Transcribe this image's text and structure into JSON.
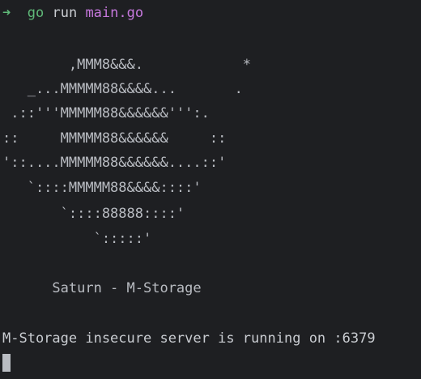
{
  "terminal": {
    "prompt": {
      "arrow": "➜",
      "command": "go",
      "subcommand": "run",
      "argument": "main.go"
    },
    "ascii_art": [
      "        ,MMM8&&&.            *",
      "   _...MMMMM88&&&&...       .",
      " .::'''MMMMM88&&&&&&''':.",
      "::     MMMMM88&&&&&&     ::",
      "'::....MMMMM88&&&&&&....::'",
      "   `::::MMMMM88&&&&::::'",
      "       `::::88888::::'",
      "           `:::::'"
    ],
    "banner": "      Saturn - M-Storage",
    "output": "M-Storage insecure server is running on :6379"
  },
  "colors": {
    "background": "#1e1f22",
    "text": "#c9ccd1",
    "prompt_green": "#5fb878",
    "argument_purple": "#c678dd"
  }
}
